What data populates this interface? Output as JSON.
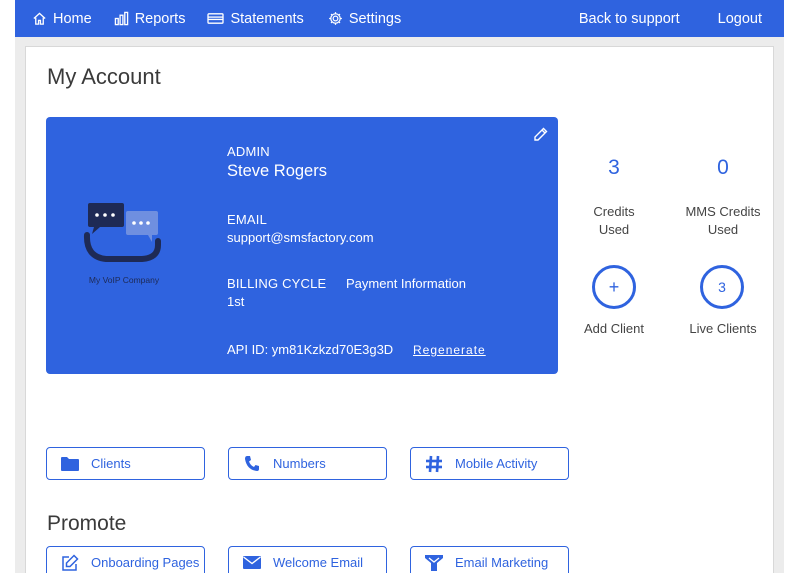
{
  "nav": {
    "home": "Home",
    "reports": "Reports",
    "statements": "Statements",
    "settings": "Settings",
    "back_to_support": "Back to support",
    "logout": "Logout"
  },
  "page": {
    "title": "My Account"
  },
  "account_card": {
    "logo_text": "My VoIP Company",
    "admin_label": "ADMIN",
    "admin_name": "Steve Rogers",
    "email_label": "EMAIL",
    "email_value": "support@smsfactory.com",
    "billing_label": "BILLING CYCLE",
    "billing_value": "1st",
    "payment_link": "Payment Information",
    "api_id": "API ID: ym81Kzkzd70E3g3D",
    "regenerate": "Regenerate"
  },
  "stats": {
    "credits_used_value": "3",
    "credits_used_label_line1": "Credits",
    "credits_used_label_line2": "Used",
    "mms_credits_value": "0",
    "mms_credits_label_line1": "MMS Credits",
    "mms_credits_label_line2": "Used",
    "add_client_symbol": "+",
    "add_client_label": "Add Client",
    "live_clients_value": "3",
    "live_clients_label": "Live Clients"
  },
  "actions": {
    "clients": "Clients",
    "numbers": "Numbers",
    "mobile_activity": "Mobile Activity"
  },
  "promote": {
    "title": "Promote",
    "onboarding_pages": "Onboarding Pages",
    "welcome_email": "Welcome Email",
    "email_marketing": "Email Marketing"
  },
  "colors": {
    "brand": "#2f63df",
    "frame": "#ececec",
    "logo_navy": "#1e2a55"
  },
  "icons": {
    "home": "home-icon",
    "reports": "bar-chart-icon",
    "statements": "statements-icon",
    "settings": "gear-icon",
    "edit": "pencil-icon",
    "clients": "folder-icon",
    "numbers": "phone-icon",
    "mobile_activity": "hashtag-icon",
    "onboarding": "edit-square-icon",
    "welcome_email": "envelope-icon",
    "email_marketing": "marketing-icon"
  }
}
